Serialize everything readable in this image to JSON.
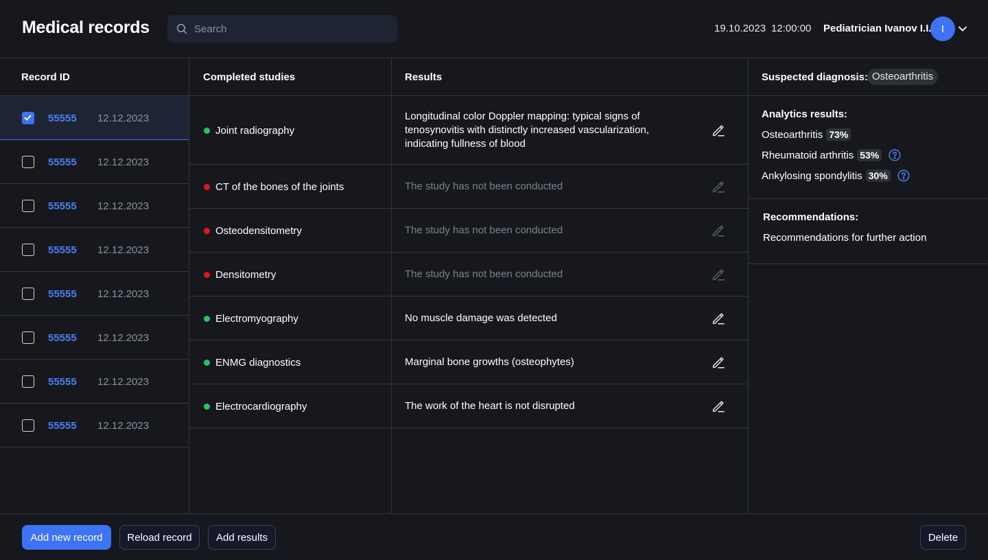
{
  "header": {
    "title": "Medical records",
    "search_placeholder": "Search",
    "date": "19.10.2023",
    "time": "12:00:00",
    "user": "Pediatrician Ivanov I.I.",
    "avatar_initial": "I"
  },
  "columns": {
    "record_id": "Record ID",
    "completed_studies": "Completed studies",
    "results": "Results"
  },
  "records": [
    {
      "id": "55555",
      "date": "12.12.2023",
      "checked": true
    },
    {
      "id": "55555",
      "date": "12.12.2023",
      "checked": false
    },
    {
      "id": "55555",
      "date": "12.12.2023",
      "checked": false
    },
    {
      "id": "55555",
      "date": "12.12.2023",
      "checked": false
    },
    {
      "id": "55555",
      "date": "12.12.2023",
      "checked": false
    },
    {
      "id": "55555",
      "date": "12.12.2023",
      "checked": false
    },
    {
      "id": "55555",
      "date": "12.12.2023",
      "checked": false
    },
    {
      "id": "55555",
      "date": "12.12.2023",
      "checked": false
    }
  ],
  "studies": [
    {
      "name": "Joint radiography",
      "status": "done",
      "result": "Longitudinal color Doppler mapping: typical signs of tenosynovitis with distinctly increased vascularization, indicating fullness of blood"
    },
    {
      "name": "CT of the bones of the joints",
      "status": "not-done",
      "result": "The study has not been conducted"
    },
    {
      "name": "Osteodensitometry",
      "status": "not-done",
      "result": "The study has not been conducted"
    },
    {
      "name": "Densitometry",
      "status": "not-done",
      "result": "The study has not been conducted"
    },
    {
      "name": "Electromyography",
      "status": "done",
      "result": "No muscle damage was detected"
    },
    {
      "name": "ENMG diagnostics",
      "status": "done",
      "result": "Marginal bone growths (osteophytes)"
    },
    {
      "name": "Electrocardiography",
      "status": "done",
      "result": "The work of the heart is not disrupted"
    }
  ],
  "diagnosis": {
    "label": "Suspected diagnosis:",
    "value": "Osteoarthritis"
  },
  "analytics": {
    "title": "Analytics results:",
    "items": [
      {
        "name": "Osteoarthritis",
        "percent": "73%",
        "help": false
      },
      {
        "name": "Rheumatoid arthritis",
        "percent": "53%",
        "help": true
      },
      {
        "name": "Ankylosing spondylitis",
        "percent": "30%",
        "help": true
      }
    ]
  },
  "recommendations": {
    "title": "Recommendations:",
    "text": "Recommendations for further action"
  },
  "footer": {
    "add_new": "Add new record",
    "reload": "Reload record",
    "add_results": "Add results",
    "delete": "Delete"
  },
  "colors": {
    "accent": "#3d73f5",
    "status_done": "#22c55e",
    "status_not_done": "#e5141a"
  }
}
